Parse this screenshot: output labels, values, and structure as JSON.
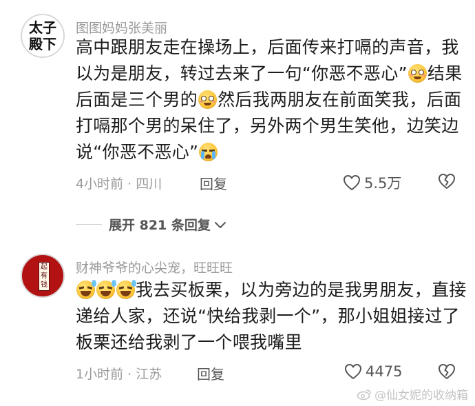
{
  "comments": [
    {
      "avatar_text": [
        "太子",
        "殿下"
      ],
      "username": "图图妈妈张美丽",
      "text_parts": [
        "高中跟朋友走在操场上，后面传来打嗝的声音，我以为是朋友，转过去来了一句“你恶不恶心”",
        "结果后面是三个男的",
        "然后我两朋友在前面笑我，后面打嗝那个男的呆住了，另外两个男生笑他，边笑边说“你恶不恶心”"
      ],
      "time": "4小时前",
      "location": "四川",
      "reply_label": "回复",
      "likes": "5.5万"
    },
    {
      "avatar_text": [
        "起",
        "有",
        "钱"
      ],
      "username": "财神爷爷的心尖宠，旺旺旺",
      "text_parts": [
        "我去买板栗，以为旁边的是我男朋友，直接递给人家，还说“快给我剥一个”，那小姐姐接过了板栗还给我剥了一个喂我嘴里"
      ],
      "time": "1小时前",
      "location": "江苏",
      "reply_label": "回复",
      "likes": "4475"
    }
  ],
  "expand_replies": "展开 821 条回复",
  "watermark": "@仙女妮的收纳箱",
  "icons": {
    "like": "heart-outline-icon",
    "dislike": "broken-heart-icon",
    "expand": "chevron-down-icon",
    "watermark": "weibo-logo-icon",
    "emoji_1": "smiling-blush-emoji",
    "emoji_2": "crying-emoji",
    "emoji_3": "sweat-smile-emoji"
  },
  "colors": {
    "meta": "#9a9a9a",
    "text": "#1c1c1c",
    "avatar_red": "#b31212"
  }
}
